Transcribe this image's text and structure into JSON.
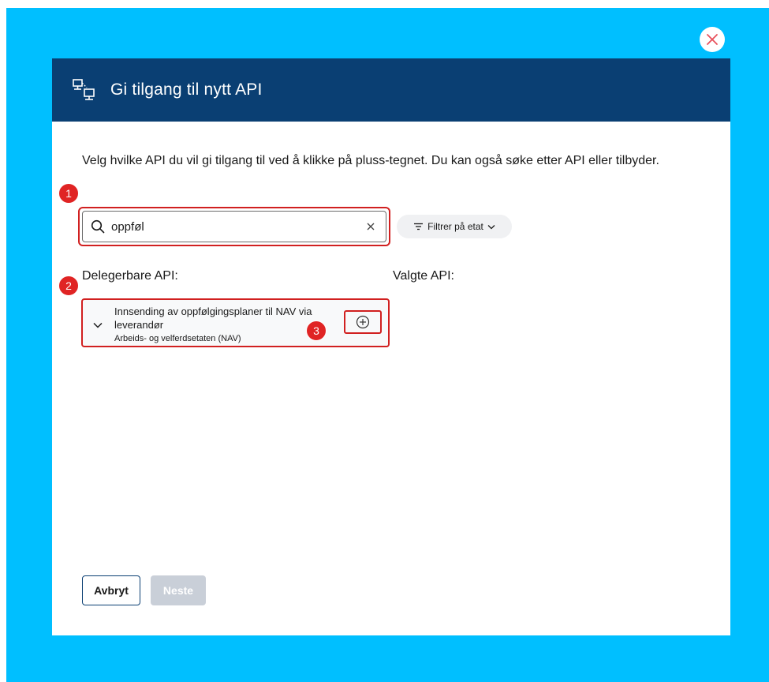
{
  "dialog": {
    "title": "Gi tilgang til nytt API",
    "intro": "Velg hvilke API du vil gi tilgang til ved å klikke på pluss-tegnet. Du kan også søke etter API eller tilbyder."
  },
  "search": {
    "value": "oppføl",
    "placeholder": ""
  },
  "filter": {
    "label": "Filtrer på etat"
  },
  "sections": {
    "delegable_label": "Delegerbare API:",
    "selected_label": "Valgte API:"
  },
  "api_items": [
    {
      "title": "Innsending av oppfølgingsplaner til NAV via leverandør",
      "provider": "Arbeids- og velferdsetaten (NAV)"
    }
  ],
  "annotations": [
    "1",
    "2",
    "3"
  ],
  "footer": {
    "cancel_label": "Avbryt",
    "next_label": "Neste"
  },
  "colors": {
    "backdrop": "#00bfff",
    "header": "#0a3f73",
    "highlight": "#d12020",
    "close_icon": "#e8505b"
  },
  "icons": {
    "header": "network-icon",
    "close": "close-icon",
    "search": "search-icon",
    "clear": "clear-icon",
    "filter": "filter-icon",
    "chevron": "chevron-down-icon",
    "add": "plus-circle-icon"
  }
}
